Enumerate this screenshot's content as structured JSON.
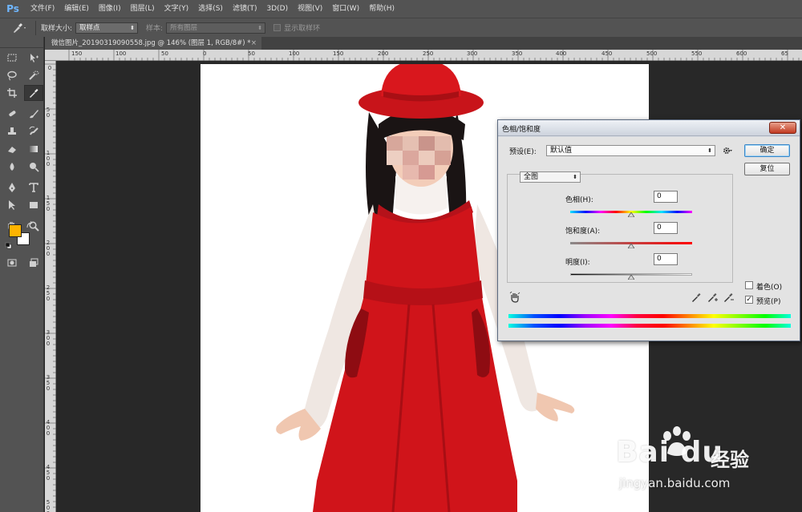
{
  "app": {
    "logo": "Ps",
    "menu": [
      "文件(F)",
      "编辑(E)",
      "图像(I)",
      "图层(L)",
      "文字(Y)",
      "选择(S)",
      "滤镜(T)",
      "3D(D)",
      "视图(V)",
      "窗口(W)",
      "帮助(H)"
    ]
  },
  "options": {
    "tool_icon": "eyedropper-icon",
    "sample_size_label": "取样大小:",
    "sample_size_value": "取样点",
    "sample_label": "样本:",
    "sample_value": "所有图层",
    "show_ring_label": "显示取样环"
  },
  "document": {
    "tab_title": "微信图片_20190319090558.jpg @ 146% (图层 1, RGB/8#) *",
    "close_glyph": "×",
    "ruler_top": [
      "150",
      "100",
      "50",
      "0",
      "50",
      "100",
      "150",
      "200",
      "250",
      "300",
      "350",
      "400",
      "450",
      "500",
      "550",
      "600",
      "65"
    ],
    "ruler_left": [
      "0",
      "5 0",
      "1 0 0",
      "1 5 0",
      "2 0 0",
      "2 5 0",
      "3 0 0",
      "3 5 0",
      "4 0 0",
      "4 5 0",
      "5 0 0"
    ]
  },
  "colors": {
    "foreground": "#ffb400",
    "background": "#ffffff",
    "dress_red": "#d0141a",
    "hat_red": "#d3161c"
  },
  "dialog": {
    "title": "色相/饱和度",
    "close_glyph": "✕",
    "preset_label": "预设(E):",
    "preset_value": "默认值",
    "channel_value": "全图",
    "hue_label": "色相(H):",
    "hue_value": "0",
    "saturation_label": "饱和度(A):",
    "saturation_value": "0",
    "lightness_label": "明度(I):",
    "lightness_value": "0",
    "ok_label": "确定",
    "reset_label": "复位",
    "colorize_label": "着色(O)",
    "colorize_checked": false,
    "preview_label": "预览(P)",
    "preview_checked": true,
    "preview_check_glyph": "✓"
  },
  "watermark": {
    "logo": "Bai du",
    "text": "经验",
    "url": "jingyan.baidu.com"
  }
}
